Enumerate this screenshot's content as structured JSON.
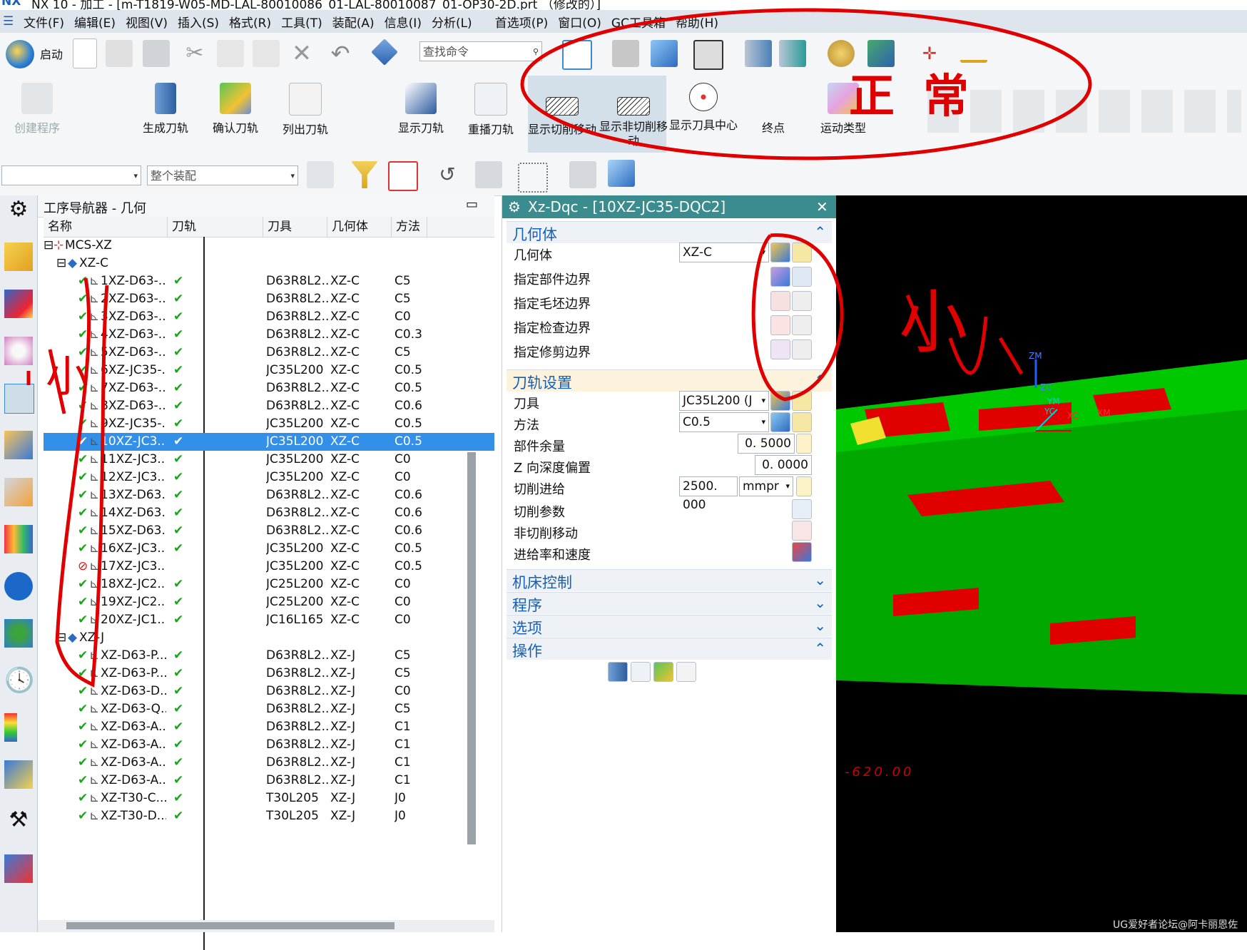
{
  "window": {
    "title": "NX 10 - 加工 - [m-T1819-W05-MD-LAL-80010086_01-LAL-80010087_01-OP30-2D.prt （修改的）]"
  },
  "menu": [
    "文件(F)",
    "编辑(E)",
    "视图(V)",
    "插入(S)",
    "格式(R)",
    "工具(T)",
    "装配(A)",
    "信息(I)",
    "分析(L)",
    "首选项(P)",
    "窗口(O)",
    "GC工具箱",
    "帮助(H)"
  ],
  "toolbar": {
    "start_label": "启动",
    "search_placeholder": "查找命令"
  },
  "ribbon": {
    "buttons": [
      "创建程序",
      "生成刀轨",
      "确认刀轨",
      "列出刀轨",
      "显示刀轨",
      "重播刀轨",
      "显示切削移动",
      "显示非切削移动",
      "显示刀具中心",
      "终点",
      "运动类型"
    ]
  },
  "selection_bar": {
    "filter_value": "",
    "scope_value": "整个装配"
  },
  "annotations": {
    "toolbar_note": "正常",
    "tree_note": "小",
    "dialog_note": "小"
  },
  "navigator": {
    "title": "工序导航器 - 几何",
    "columns": [
      "名称",
      "刀轨",
      "刀具",
      "几何体",
      "方法"
    ],
    "root": "MCS-XZ",
    "groups": [
      {
        "name": "XZ-C",
        "rows": [
          {
            "name": "1XZ-D63-...",
            "status": "ok",
            "tool": "D63R8L2...",
            "geom": "XZ-C",
            "method": "C5"
          },
          {
            "name": "2XZ-D63-...",
            "status": "ok",
            "tool": "D63R8L2...",
            "geom": "XZ-C",
            "method": "C5"
          },
          {
            "name": "3XZ-D63-...",
            "status": "ok",
            "tool": "D63R8L2...",
            "geom": "XZ-C",
            "method": "C0"
          },
          {
            "name": "4XZ-D63-...",
            "status": "ok",
            "tool": "D63R8L2...",
            "geom": "XZ-C",
            "method": "C0.3"
          },
          {
            "name": "5XZ-D63-...",
            "status": "ok",
            "tool": "D63R8L2...",
            "geom": "XZ-C",
            "method": "C5"
          },
          {
            "name": "6XZ-JC35-...",
            "status": "ok",
            "tool": "JC35L200",
            "geom": "XZ-C",
            "method": "C0.5"
          },
          {
            "name": "7XZ-D63-...",
            "status": "ok",
            "tool": "D63R8L2...",
            "geom": "XZ-C",
            "method": "C0.5"
          },
          {
            "name": "8XZ-D63-...",
            "status": "ok",
            "tool": "D63R8L2...",
            "geom": "XZ-C",
            "method": "C0.6"
          },
          {
            "name": "9XZ-JC35-...",
            "status": "ok",
            "tool": "JC35L200",
            "geom": "XZ-C",
            "method": "C0.5"
          },
          {
            "name": "10XZ-JC3...",
            "status": "ok",
            "tool": "JC35L200",
            "geom": "XZ-C",
            "method": "C0.5",
            "selected": true
          },
          {
            "name": "11XZ-JC3...",
            "status": "ok",
            "tool": "JC35L200",
            "geom": "XZ-C",
            "method": "C0"
          },
          {
            "name": "12XZ-JC3...",
            "status": "ok",
            "tool": "JC35L200",
            "geom": "XZ-C",
            "method": "C0"
          },
          {
            "name": "13XZ-D63...",
            "status": "ok",
            "tool": "D63R8L2...",
            "geom": "XZ-C",
            "method": "C0.6"
          },
          {
            "name": "14XZ-D63...",
            "status": "ok",
            "tool": "D63R8L2...",
            "geom": "XZ-C",
            "method": "C0.6"
          },
          {
            "name": "15XZ-D63...",
            "status": "ok",
            "tool": "D63R8L2...",
            "geom": "XZ-C",
            "method": "C0.6"
          },
          {
            "name": "16XZ-JC3...",
            "status": "ok",
            "tool": "JC35L200",
            "geom": "XZ-C",
            "method": "C0.5"
          },
          {
            "name": "17XZ-JC3...",
            "status": "blocked",
            "tool": "JC35L200",
            "geom": "XZ-C",
            "method": "C0.5"
          },
          {
            "name": "18XZ-JC2...",
            "status": "ok",
            "tool": "JC25L200",
            "geom": "XZ-C",
            "method": "C0"
          },
          {
            "name": "19XZ-JC2...",
            "status": "ok",
            "tool": "JC25L200",
            "geom": "XZ-C",
            "method": "C0"
          },
          {
            "name": "20XZ-JC1...",
            "status": "ok",
            "tool": "JC16L165",
            "geom": "XZ-C",
            "method": "C0"
          }
        ]
      },
      {
        "name": "XZ-J",
        "rows": [
          {
            "name": "XZ-D63-P...",
            "status": "ok",
            "tool": "D63R8L2...",
            "geom": "XZ-J",
            "method": "C5"
          },
          {
            "name": "XZ-D63-P...",
            "status": "ok",
            "tool": "D63R8L2...",
            "geom": "XZ-J",
            "method": "C5"
          },
          {
            "name": "XZ-D63-D...",
            "status": "ok",
            "tool": "D63R8L2...",
            "geom": "XZ-J",
            "method": "C0"
          },
          {
            "name": "XZ-D63-Q...",
            "status": "ok",
            "tool": "D63R8L2...",
            "geom": "XZ-J",
            "method": "C5"
          },
          {
            "name": "XZ-D63-A...",
            "status": "ok",
            "tool": "D63R8L2...",
            "geom": "XZ-J",
            "method": "C1"
          },
          {
            "name": "XZ-D63-A...",
            "status": "ok",
            "tool": "D63R8L2...",
            "geom": "XZ-J",
            "method": "C1"
          },
          {
            "name": "XZ-D63-A...",
            "status": "ok",
            "tool": "D63R8L2...",
            "geom": "XZ-J",
            "method": "C1"
          },
          {
            "name": "XZ-D63-A...",
            "status": "ok",
            "tool": "D63R8L2...",
            "geom": "XZ-J",
            "method": "C1"
          },
          {
            "name": "XZ-T30-C...",
            "status": "ok",
            "tool": "T30L205",
            "geom": "XZ-J",
            "method": "J0"
          },
          {
            "name": "XZ-T30-D...",
            "status": "ok",
            "tool": "T30L205",
            "geom": "XZ-J",
            "method": "J0"
          }
        ]
      }
    ]
  },
  "dialog": {
    "title": "Xz-Dqc - [10XZ-JC35-DQC2]",
    "geometry": {
      "header": "几何体",
      "geometry_label": "几何体",
      "geometry_value": "XZ-C",
      "part_boundary": "指定部件边界",
      "blank_boundary": "指定毛坯边界",
      "check_boundary": "指定检查边界",
      "trim_boundary": "指定修剪边界"
    },
    "path_settings": {
      "header": "刀轨设置",
      "tool_label": "刀具",
      "tool_value": "JC35L200 (J",
      "method_label": "方法",
      "method_value": "C0.5",
      "stock_label": "部件余量",
      "stock_value": "0. 5000",
      "zoffset_label": "Z 向深度偏置",
      "zoffset_value": "0. 0000",
      "feed_label": "切削进给",
      "feed_value": "2500. 000",
      "feed_unit": "mmpr",
      "cut_params": "切削参数",
      "noncut_moves": "非切削移动",
      "feeds_speeds": "进给率和速度"
    },
    "collapsed_sections": [
      "机床控制",
      "程序",
      "选项"
    ],
    "actions_header": "操作"
  },
  "viewport": {
    "axes": [
      "ZM",
      "ZC",
      "YM",
      "YC",
      "XC",
      "XM"
    ],
    "dimension_text": "-620.00",
    "watermark": "UG爱好者论坛@阿卡丽恩佐斯"
  },
  "colors": {
    "model": "#00b000",
    "faces": "#e00000",
    "selection": "#3390e8",
    "dialog_title": "#3a8c8f",
    "annotation": "#e00000"
  }
}
